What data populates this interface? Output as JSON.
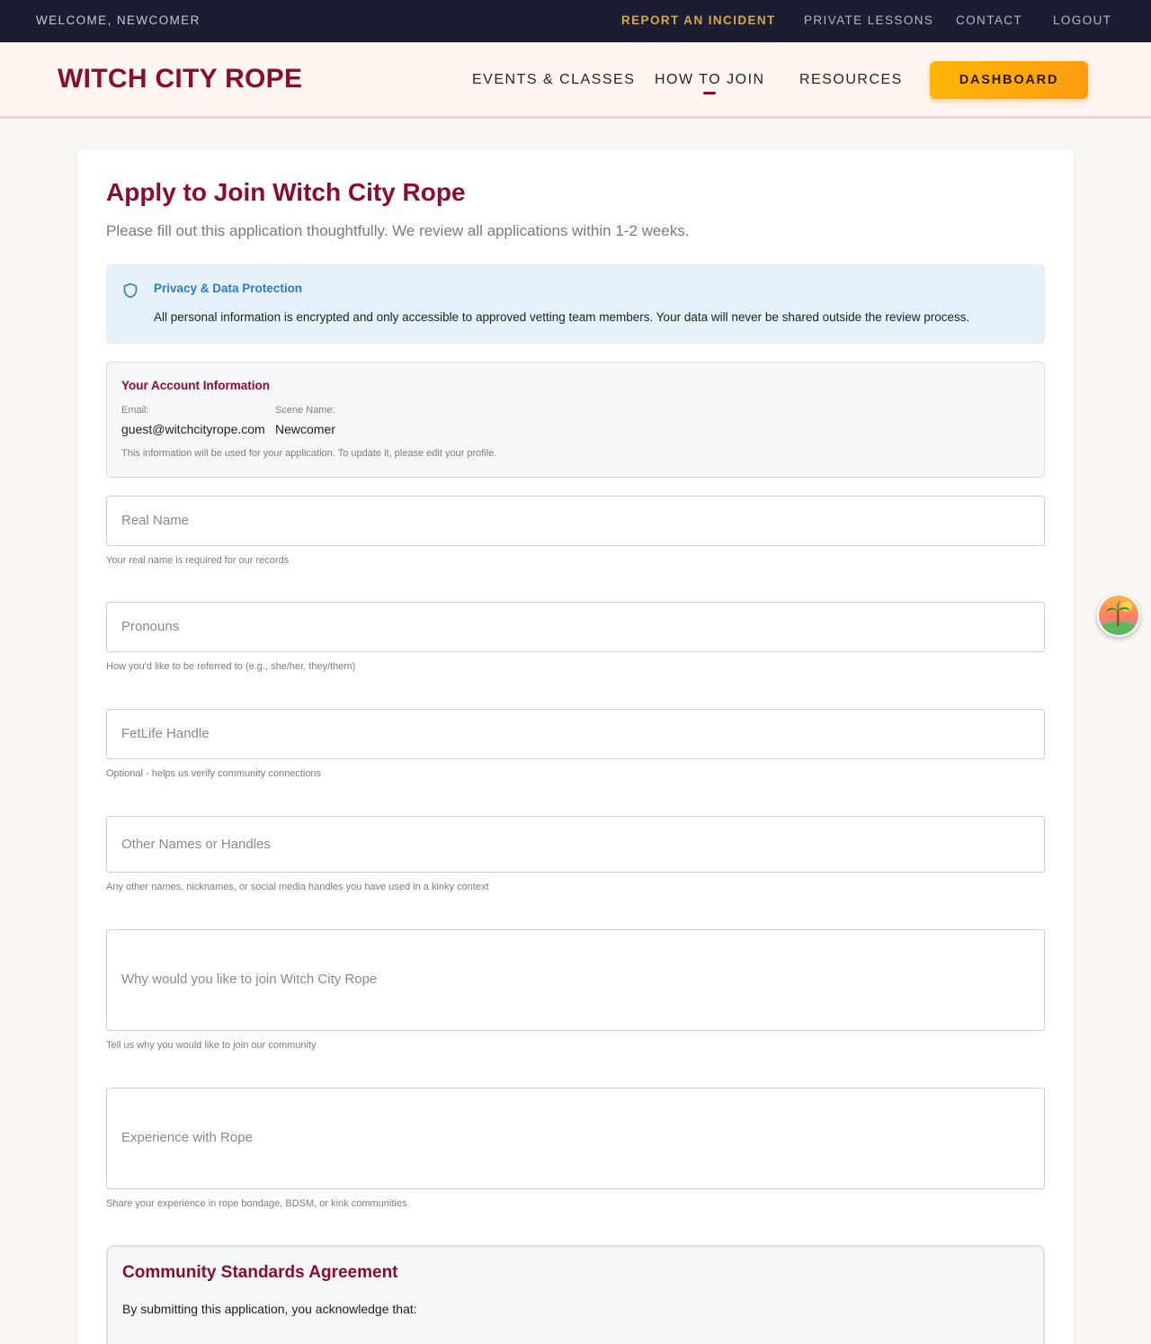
{
  "utility_bar": {
    "welcome": "WELCOME, NEWCOMER",
    "links": {
      "report_incident": "REPORT AN INCIDENT",
      "private_lessons": "PRIVATE LESSONS",
      "contact": "CONTACT",
      "logout": "LOGOUT"
    }
  },
  "header": {
    "logo": "WITCH CITY ROPE",
    "nav": {
      "events": "EVENTS & CLASSES",
      "how_to_join": "HOW TO JOIN",
      "resources": "RESOURCES"
    },
    "dashboard_button": "DASHBOARD"
  },
  "form": {
    "title": "Apply to Join Witch City Rope",
    "subtitle": "Please fill out this application thoughtfully. We review all applications within 1-2 weeks.",
    "privacy": {
      "title": "Privacy & Data Protection",
      "text": "All personal information is encrypted and only accessible to approved vetting team members. Your data will never be shared outside the review process."
    },
    "account": {
      "title": "Your Account Information",
      "email_label": "Email:",
      "email_value": "guest@witchcityrope.com",
      "scene_label": "Scene Name:",
      "scene_value": "Newcomer",
      "note": "This information will be used for your application. To update it, please edit your profile."
    },
    "fields": [
      {
        "placeholder": "Real Name",
        "help": "Your real name is required for our records"
      },
      {
        "placeholder": "Pronouns",
        "help": "How you'd like to be referred to (e.g., she/her, they/them)"
      },
      {
        "placeholder": "FetLife Handle",
        "help": "Optional - helps us verify community connections"
      },
      {
        "placeholder": "Other Names or Handles",
        "help": "Any other names, nicknames, or social media handles you have used in a kinky context"
      },
      {
        "placeholder": "Why would you like to join Witch City Rope",
        "help": "Tell us why you would like to join our community"
      },
      {
        "placeholder": "Experience with Rope",
        "help": "Share your experience in rope bondage, BDSM, or kink communities"
      }
    ],
    "standards": {
      "title": "Community Standards Agreement",
      "text": "By submitting this application, you acknowledge that:"
    }
  },
  "colors": {
    "brand": "#880d2e",
    "utility_bar": "#1c1d33",
    "accent_gold": "#d4a84b",
    "dashboard_button": "#ffb60a",
    "privacy_bg": "#e6f1fb",
    "privacy_title": "#2b7bc6"
  },
  "icons": {
    "privacy": "shield-icon",
    "floating_widget": "island-avatar-icon"
  }
}
